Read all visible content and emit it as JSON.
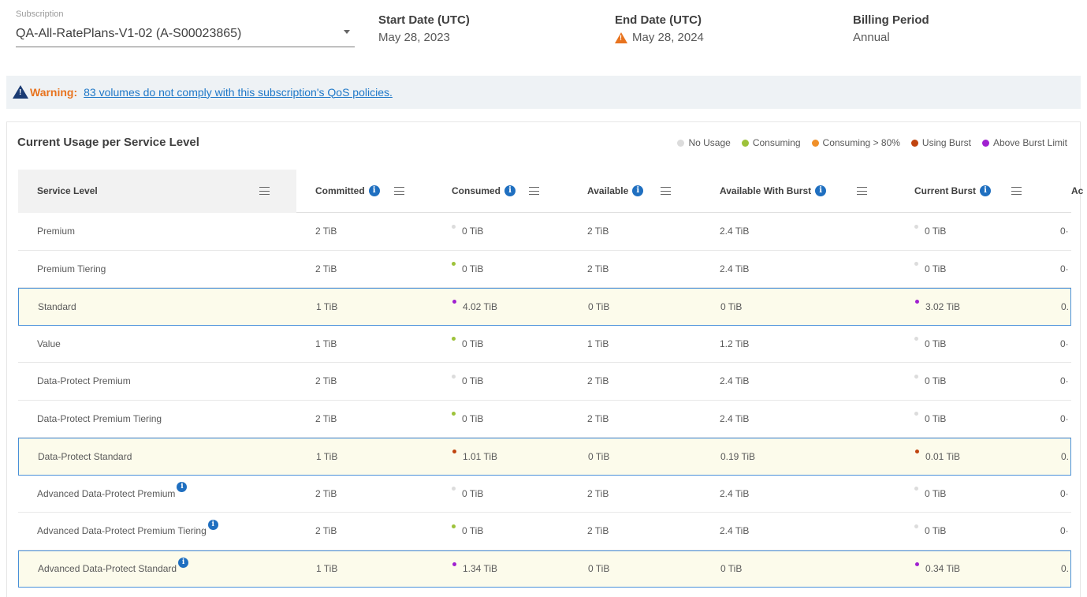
{
  "header": {
    "subscription_label": "Subscription",
    "subscription_value": "QA-All-RatePlans-V1-02 (A-S00023865)",
    "start_title": "Start Date (UTC)",
    "start_value": "May 28, 2023",
    "end_title": "End Date (UTC)",
    "end_value": "May 28, 2024",
    "billing_title": "Billing Period",
    "billing_value": "Annual"
  },
  "banner": {
    "label": "Warning:",
    "link": "83 volumes do not comply with this subscription's QoS policies."
  },
  "usage": {
    "title": "Current Usage per Service Level",
    "legend": [
      {
        "label": "No Usage",
        "color": "#dcdcdc"
      },
      {
        "label": "Consuming",
        "color": "#9dc23a"
      },
      {
        "label": "Consuming > 80%",
        "color": "#f0902a"
      },
      {
        "label": "Using Burst",
        "color": "#c0440f"
      },
      {
        "label": "Above Burst Limit",
        "color": "#a020d0"
      }
    ],
    "columns": [
      "Service Level",
      "Committed",
      "Consumed",
      "Available",
      "Available With Burst",
      "Current Burst",
      "Ac"
    ],
    "rows": [
      {
        "level": "Premium",
        "committed": "2 TiB",
        "consumed": "0 TiB",
        "available": "2 TiB",
        "burst_avail": "2.4 TiB",
        "current_burst": "0 TiB",
        "extra": "0·"
      },
      {
        "level": "Premium Tiering",
        "committed": "2 TiB",
        "consumed": "0 TiB",
        "available": "2 TiB",
        "burst_avail": "2.4 TiB",
        "current_burst": "0 TiB",
        "extra": "0·"
      },
      {
        "level": "Standard",
        "committed": "1 TiB",
        "consumed": "4.02 TiB",
        "available": "0 TiB",
        "burst_avail": "0 TiB",
        "current_burst": "3.02 TiB",
        "extra": "0."
      },
      {
        "level": "Value",
        "committed": "1 TiB",
        "consumed": "0 TiB",
        "available": "1 TiB",
        "burst_avail": "1.2 TiB",
        "current_burst": "0 TiB",
        "extra": "0·"
      },
      {
        "level": "Data-Protect Premium",
        "committed": "2 TiB",
        "consumed": "0 TiB",
        "available": "2 TiB",
        "burst_avail": "2.4 TiB",
        "current_burst": "0 TiB",
        "extra": "0·"
      },
      {
        "level": "Data-Protect Premium Tiering",
        "committed": "2 TiB",
        "consumed": "0 TiB",
        "available": "2 TiB",
        "burst_avail": "2.4 TiB",
        "current_burst": "0 TiB",
        "extra": "0·"
      },
      {
        "level": "Data-Protect Standard",
        "committed": "1 TiB",
        "consumed": "1.01 TiB",
        "available": "0 TiB",
        "burst_avail": "0.19 TiB",
        "current_burst": "0.01 TiB",
        "extra": "0."
      },
      {
        "level": "Advanced Data-Protect Premium",
        "committed": "2 TiB",
        "consumed": "0 TiB",
        "available": "2 TiB",
        "burst_avail": "2.4 TiB",
        "current_burst": "0 TiB",
        "extra": "0·"
      },
      {
        "level": "Advanced Data-Protect Premium Tiering",
        "committed": "2 TiB",
        "consumed": "0 TiB",
        "available": "2 TiB",
        "burst_avail": "2.4 TiB",
        "current_burst": "0 TiB",
        "extra": "0·"
      },
      {
        "level": "Advanced Data-Protect Standard",
        "committed": "1 TiB",
        "consumed": "1.34 TiB",
        "available": "0 TiB",
        "burst_avail": "0 TiB",
        "current_burst": "0.34 TiB",
        "extra": "0."
      }
    ]
  }
}
